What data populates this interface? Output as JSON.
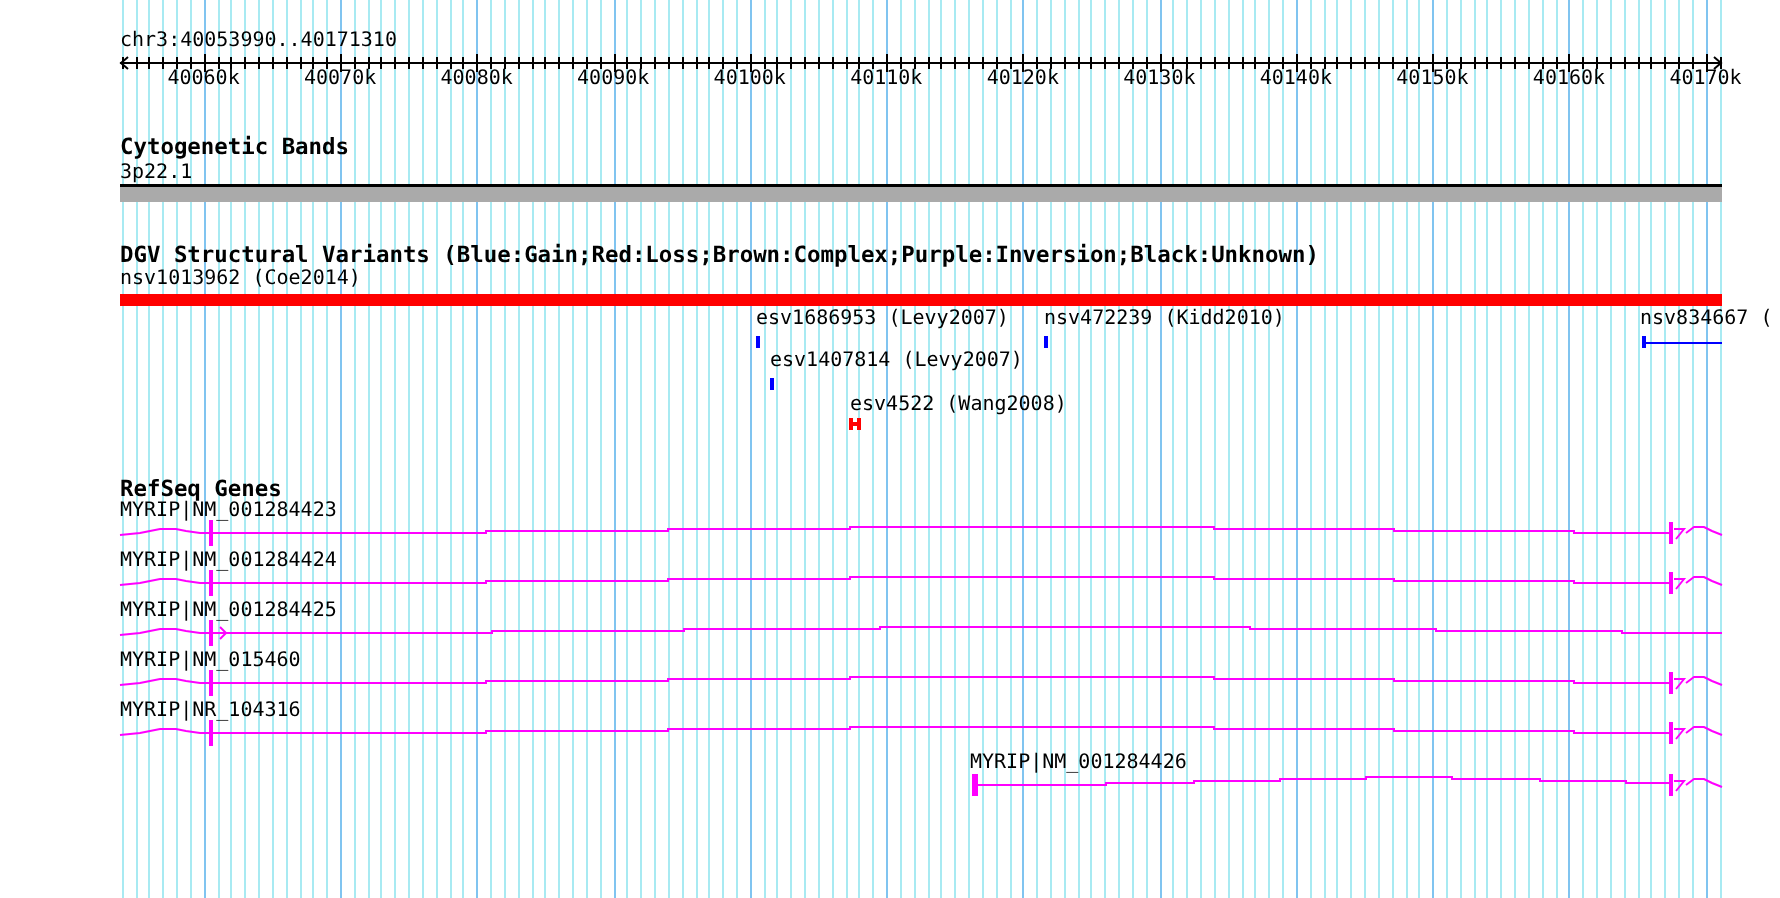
{
  "ruler": {
    "range": "chr3:40053990..40171310",
    "ticks": [
      "40060k",
      "40070k",
      "40080k",
      "40090k",
      "40100k",
      "40110k",
      "40120k",
      "40130k",
      "40140k",
      "40150k",
      "40160k",
      "40170k"
    ]
  },
  "tracks": [
    {
      "kind": "band",
      "title": "Cytogenetic Bands",
      "features": [
        {
          "label": "3p22.1"
        }
      ]
    },
    {
      "kind": "variant",
      "title": "DGV Structural Variants (Blue:Gain;Red:Loss;Brown:Complex;Purple:Inversion;Black:Unknown)",
      "features": [
        {
          "label": "nsv1013962 (Coe2014)",
          "color": "#ff0000"
        },
        {
          "label": "esv1686953 (Levy2007)",
          "color": "#0000ff"
        },
        {
          "label": "nsv472239 (Kidd2010)",
          "color": "#0000ff"
        },
        {
          "label": "nsv834667 (",
          "color": "#0000ff"
        },
        {
          "label": "esv1407814 (Levy2007)",
          "color": "#0000ff"
        },
        {
          "label": "esv4522 (Wang2008)",
          "color": "#ff0000"
        }
      ]
    },
    {
      "kind": "gene",
      "title": "RefSeq Genes",
      "features": [
        {
          "label": "MYRIP|NM_001284423"
        },
        {
          "label": "MYRIP|NM_001284424"
        },
        {
          "label": "MYRIP|NM_001284425"
        },
        {
          "label": "MYRIP|NM_015460"
        },
        {
          "label": "MYRIP|NR_104316"
        },
        {
          "label": "MYRIP|NM_001284426"
        }
      ]
    }
  ]
}
